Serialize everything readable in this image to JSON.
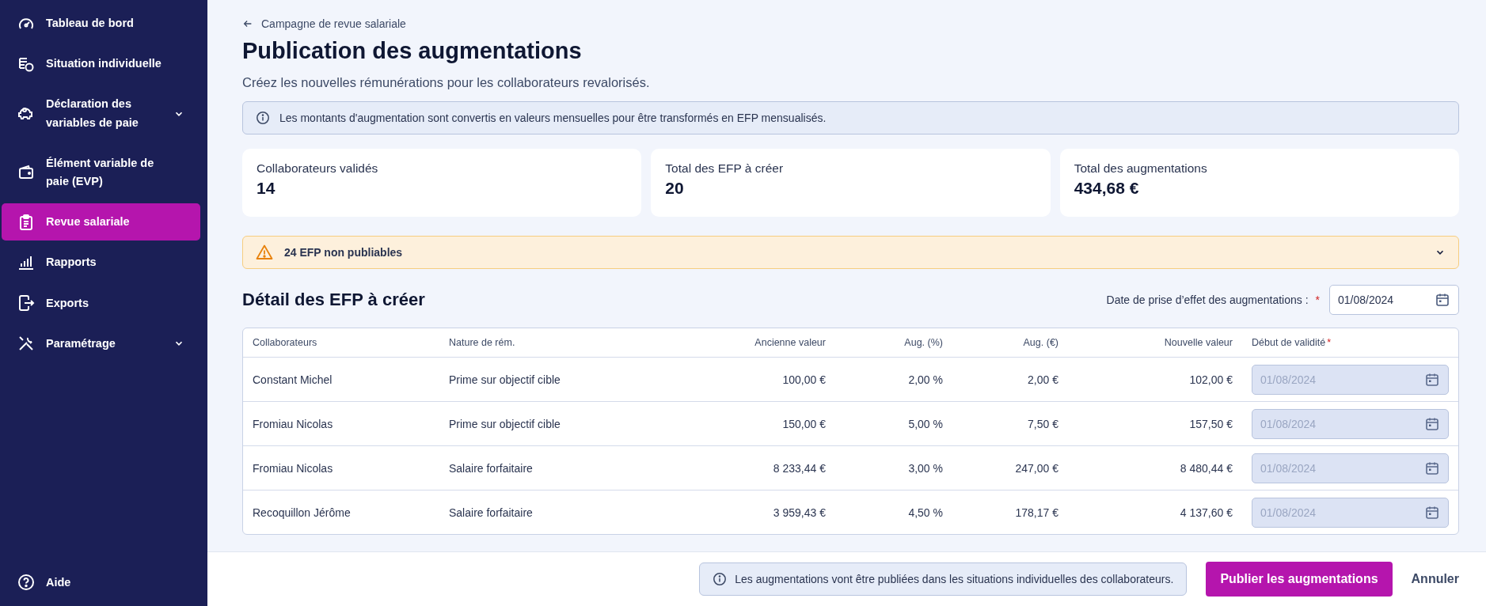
{
  "sidebar": {
    "items": [
      {
        "label": "Tableau de bord",
        "selected": false,
        "expandable": false
      },
      {
        "label": "Situation individuelle",
        "selected": false,
        "expandable": false
      },
      {
        "label": "Déclaration des variables de paie",
        "selected": false,
        "expandable": true
      },
      {
        "label": "Élément variable de paie (EVP)",
        "selected": false,
        "expandable": false
      },
      {
        "label": "Revue salariale",
        "selected": true,
        "expandable": false
      },
      {
        "label": "Rapports",
        "selected": false,
        "expandable": false
      },
      {
        "label": "Exports",
        "selected": false,
        "expandable": false
      },
      {
        "label": "Paramétrage",
        "selected": false,
        "expandable": true
      }
    ],
    "help": "Aide"
  },
  "breadcrumb": "Campagne de revue salariale",
  "title": "Publication des augmentations",
  "subtitle": "Créez les nouvelles rémunérations pour les collaborateurs revalorisés.",
  "info_banner": "Les montants d'augmentation sont convertis en valeurs mensuelles pour être transformés en EFP mensualisés.",
  "stats": [
    {
      "label": "Collaborateurs validés",
      "value": "14"
    },
    {
      "label": "Total des EFP à créer",
      "value": "20"
    },
    {
      "label": "Total des augmentations",
      "value": "434,68 €"
    }
  ],
  "warning": {
    "text": "24 EFP non publiables",
    "expanded": false
  },
  "section": {
    "title": "Détail des EFP à créer",
    "date_label": "Date de prise d’effet des augmentations :",
    "required_mark": "*",
    "date_value": "01/08/2024"
  },
  "table": {
    "columns": [
      {
        "label": "Collaborateurs"
      },
      {
        "label": "Nature de rém."
      },
      {
        "label": "Ancienne valeur"
      },
      {
        "label": "Aug. (%)"
      },
      {
        "label": "Aug. (€)"
      },
      {
        "label": "Nouvelle valeur"
      },
      {
        "label": "Début de validité",
        "required_mark": "*"
      }
    ],
    "rows": [
      {
        "cells": [
          "Constant Michel",
          "Prime sur objectif cible",
          "100,00 €",
          "2,00 %",
          "2,00 €",
          "102,00 €"
        ],
        "date": "01/08/2024",
        "disabled": true
      },
      {
        "cells": [
          "Fromiau Nicolas",
          "Prime sur objectif cible",
          "150,00 €",
          "5,00 %",
          "7,50 €",
          "157,50 €"
        ],
        "date": "01/08/2024",
        "disabled": true
      },
      {
        "cells": [
          "Fromiau Nicolas",
          "Salaire forfaitaire",
          "8 233,44 €",
          "3,00 %",
          "247,00 €",
          "8 480,44 €"
        ],
        "date": "01/08/2024",
        "disabled": true
      },
      {
        "cells": [
          "Recoquillon Jérôme",
          "Salaire forfaitaire",
          "3 959,43 €",
          "4,50 %",
          "178,17 €",
          "4 137,60 €"
        ],
        "date": "01/08/2024",
        "disabled": true
      }
    ]
  },
  "footer": {
    "note": "Les augmentations vont être publiées dans les situations individuelles des collaborateurs.",
    "buttons": [
      {
        "label": "Publier les augmentations",
        "kind": "primary"
      },
      {
        "label": "Annuler",
        "kind": "text"
      }
    ]
  }
}
